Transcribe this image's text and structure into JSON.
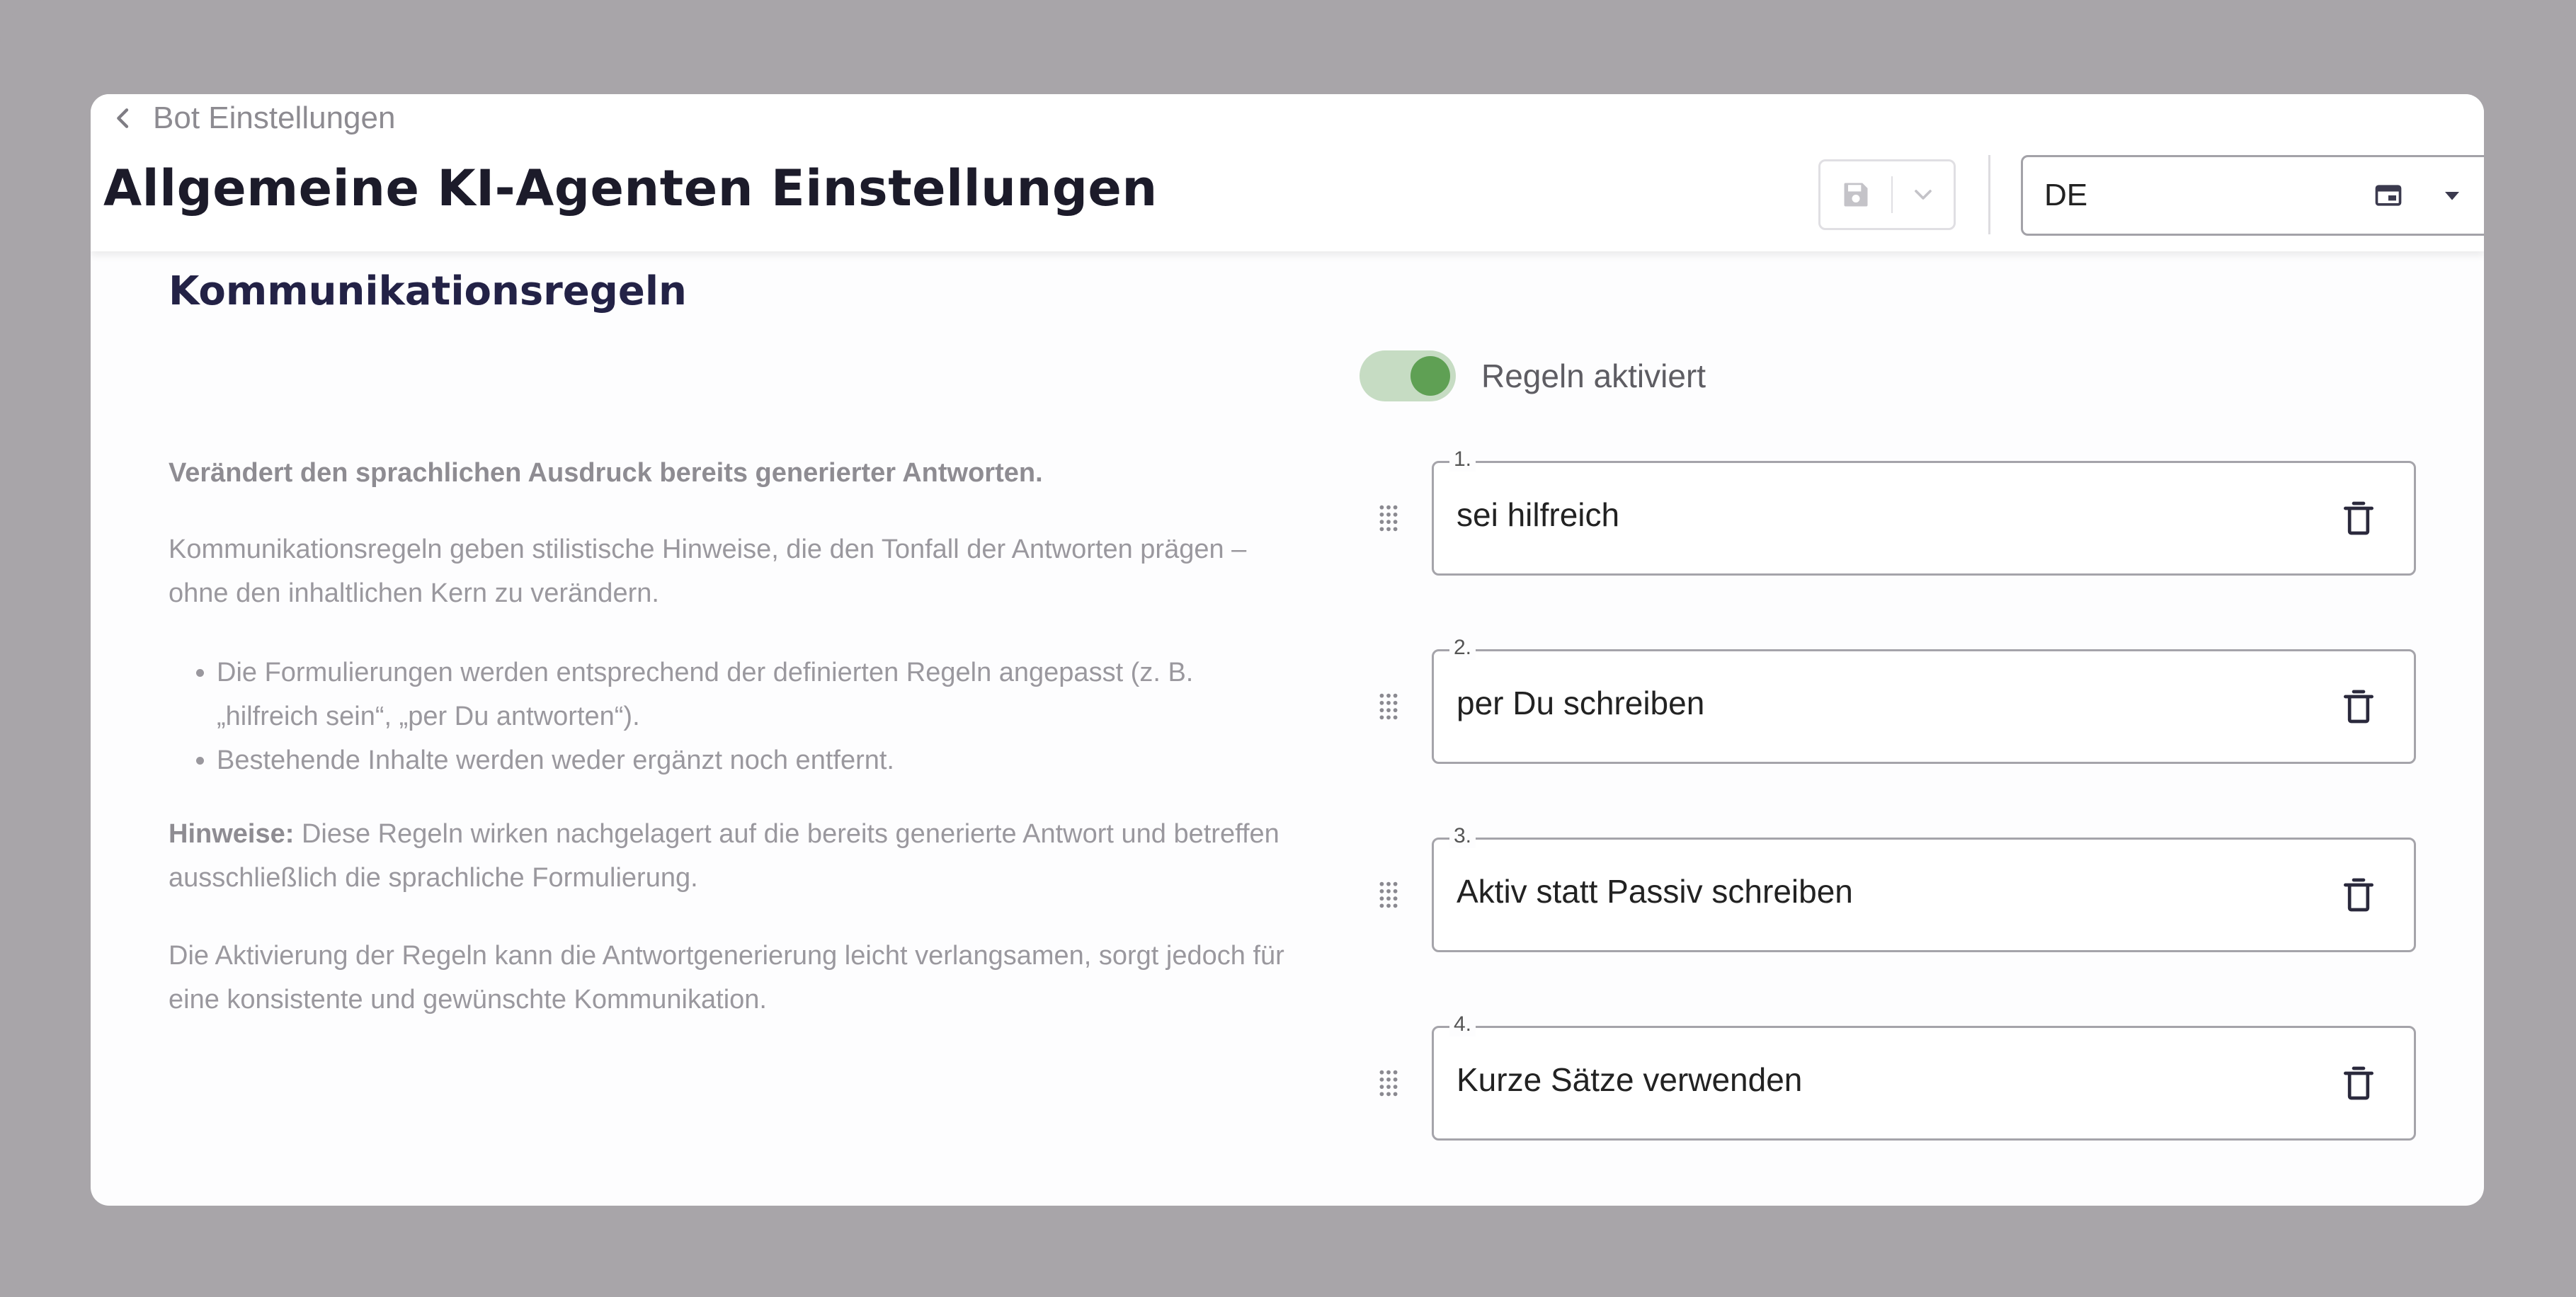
{
  "breadcrumb": {
    "label": "Bot Einstellungen"
  },
  "header": {
    "title": "Allgemeine KI-Agenten Einstellungen",
    "language": {
      "value": "DE"
    }
  },
  "section": {
    "title": "Kommunikationsregeln",
    "lead": "Verändert den sprachlichen Ausdruck bereits generierter Antworten.",
    "intro": "Kommunikationsregeln geben stilistische Hinweise, die den Tonfall der Antworten prägen – ohne den inhaltlichen Kern zu verändern.",
    "bullets": [
      "Die Formulierungen werden entsprechend der definierten Regeln angepasst (z. B. „hilfreich sein“, „per Du antworten“).",
      "Bestehende Inhalte werden weder ergänzt noch entfernt."
    ],
    "notes_label": "Hinweise:",
    "notes_text": " Diese Regeln wirken nachgelagert auf die bereits generierte Antwort und betreffen ausschließlich die sprachliche Formulierung.",
    "activation_note": "Die Aktivierung der Regeln kann die Antwortgenerierung leicht verlangsamen, sorgt jedoch für eine konsistente und gewünschte Kommunikation."
  },
  "toggle": {
    "label": "Regeln aktiviert",
    "on": true,
    "color": "#5fa054"
  },
  "rules": [
    {
      "number": "1.",
      "text": "sei hilfreich"
    },
    {
      "number": "2.",
      "text": "per Du schreiben"
    },
    {
      "number": "3.",
      "text": "Aktiv statt Passiv schreiben"
    },
    {
      "number": "4.",
      "text": "Kurze Sätze verwenden"
    }
  ]
}
